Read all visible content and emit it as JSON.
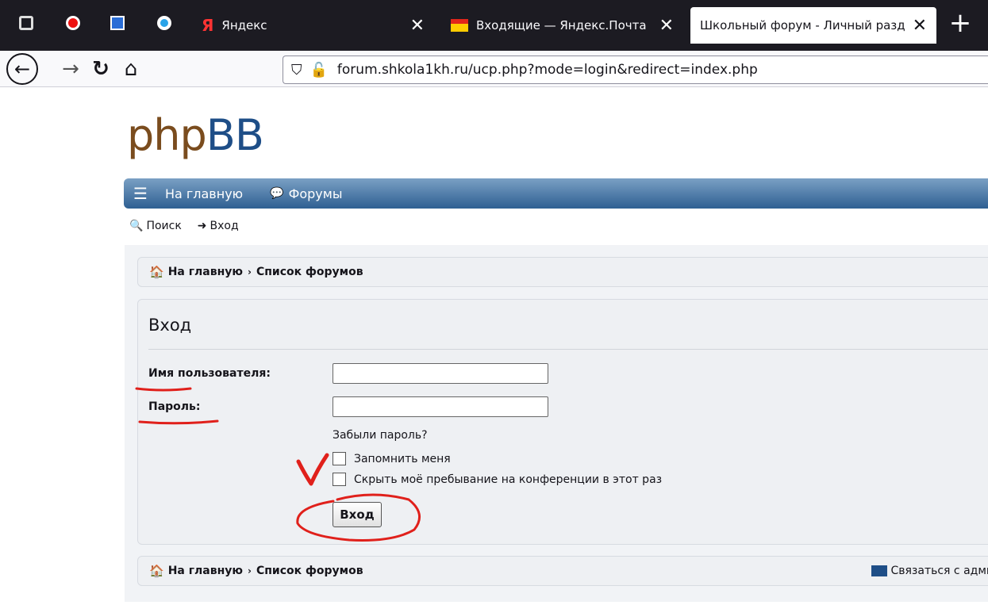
{
  "browser": {
    "tabs": [
      {
        "title": "Яндекс",
        "close": "✕"
      },
      {
        "title": "Входящие — Яндекс.Почта",
        "close": "✕"
      },
      {
        "title": "Школьный форум - Личный разд",
        "close": "✕",
        "active": true
      }
    ],
    "new_tab": "+",
    "url": "forum.shkola1kh.ru/ucp.php?mode=login&redirect=index.php",
    "icons": {
      "back": "arrow-left-icon",
      "forward": "arrow-right-icon",
      "reload": "reload-icon",
      "home": "home-icon"
    }
  },
  "site": {
    "logo_php": "php",
    "logo_bb": "BB",
    "nav": {
      "home": "На главную",
      "forums": "Форумы"
    },
    "quicklinks": {
      "search": "Поиск",
      "login": "Вход"
    },
    "breadcrumb": {
      "home": "На главную",
      "list": "Список форумов"
    },
    "contact": "Связаться с адми"
  },
  "login": {
    "title": "Вход",
    "username_label": "Имя пользователя:",
    "username_value": "",
    "password_label": "Пароль:",
    "password_value": "",
    "forgot": "Забыли пароль?",
    "remember": "Запомнить меня",
    "hide": "Скрыть моё пребывание на конференции в этот раз",
    "submit": "Вход"
  },
  "colors": {
    "nav_dark": "#2e5f92",
    "nav_light": "#7aa0c4",
    "logo_php": "#7a4c1e",
    "logo_bb": "#1e4e87",
    "annotation": "#e0201b"
  }
}
